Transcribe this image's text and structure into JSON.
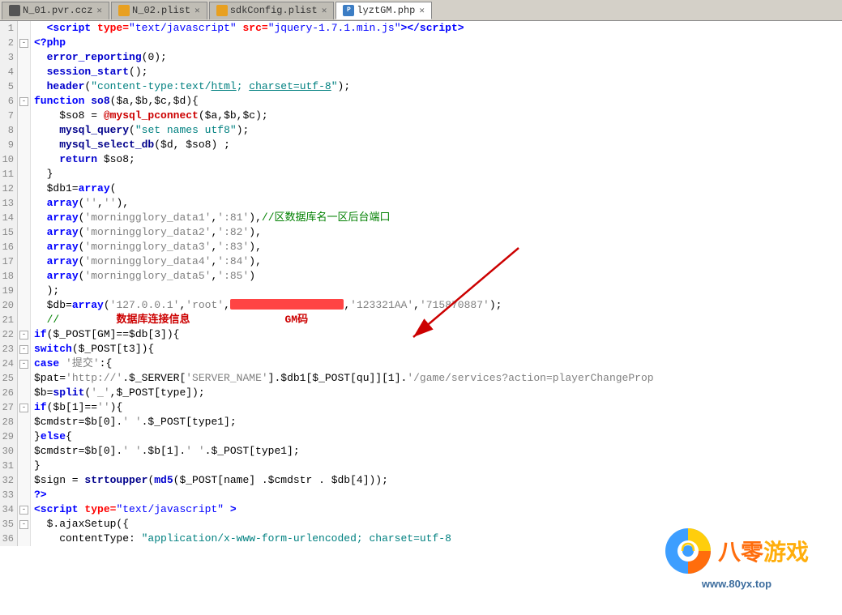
{
  "tabs": [
    {
      "id": "tab1",
      "label": "N_01.pvr.ccz",
      "type": "ccz",
      "active": false
    },
    {
      "id": "tab2",
      "label": "N_02.plist",
      "type": "plist",
      "active": false
    },
    {
      "id": "tab3",
      "label": "sdkConfig.plist",
      "type": "plist",
      "active": false
    },
    {
      "id": "tab4",
      "label": "lyztGM.php",
      "type": "php",
      "active": true
    }
  ],
  "lines": [
    {
      "num": "1",
      "fold": "",
      "code": "<script type=\"text/javascript\" src=\"jquery-1.7.1.min.js\"><\\/script>",
      "type": "html"
    },
    {
      "num": "2",
      "fold": "-",
      "code": "<?php",
      "type": "php-open"
    },
    {
      "num": "3",
      "fold": "",
      "code": "  error_reporting(0);",
      "type": "php"
    },
    {
      "num": "4",
      "fold": "",
      "code": "  session_start();",
      "type": "php"
    },
    {
      "num": "5",
      "fold": "",
      "code": "  header(\"content-type:text/html; charset=utf-8\");",
      "type": "php"
    },
    {
      "num": "6",
      "fold": "-",
      "code": "function so8($a,$b,$c,$d){",
      "type": "php-fn"
    },
    {
      "num": "7",
      "fold": "",
      "code": "    $so8 = @mysql_pconnect($a,$b,$c);",
      "type": "php"
    },
    {
      "num": "8",
      "fold": "",
      "code": "    mysql_query(\"set names utf8\");",
      "type": "php"
    },
    {
      "num": "9",
      "fold": "",
      "code": "    mysql_select_db($d, $so8) ;",
      "type": "php"
    },
    {
      "num": "10",
      "fold": "",
      "code": "    return $so8;",
      "type": "php"
    },
    {
      "num": "11",
      "fold": "",
      "code": "  }",
      "type": "php"
    },
    {
      "num": "12",
      "fold": "",
      "code": "  $db1=array(",
      "type": "php"
    },
    {
      "num": "13",
      "fold": "",
      "code": "  array('',''),",
      "type": "php"
    },
    {
      "num": "14",
      "fold": "",
      "code": "  array('morningglory_data1',':81'),//区数据库名一区后台端口",
      "type": "php-comment"
    },
    {
      "num": "15",
      "fold": "",
      "code": "  array('morningglory_data2',':82'),",
      "type": "php"
    },
    {
      "num": "16",
      "fold": "",
      "code": "  array('morningglory_data3',':83'),",
      "type": "php"
    },
    {
      "num": "17",
      "fold": "",
      "code": "  array('morningglory_data4',':84'),",
      "type": "php"
    },
    {
      "num": "18",
      "fold": "",
      "code": "  array('morningglory_data5',':85')",
      "type": "php"
    },
    {
      "num": "19",
      "fold": "",
      "code": "  );",
      "type": "php"
    },
    {
      "num": "20",
      "fold": "",
      "code": "  $db=array('127.0.0.1','root','REDACTED','123321AA','715870887');",
      "type": "php-redacted"
    },
    {
      "num": "21",
      "fold": "",
      "code": "  //          数据库连接信息                GM码",
      "type": "php-annotation"
    },
    {
      "num": "22",
      "fold": "-",
      "code": "if($_POST[GM]==$db[3]){",
      "type": "php-if"
    },
    {
      "num": "23",
      "fold": "-",
      "code": "switch($_POST[t3]){",
      "type": "php-switch"
    },
    {
      "num": "24",
      "fold": "-",
      "code": "case '提交':{",
      "type": "php-case"
    },
    {
      "num": "25",
      "fold": "",
      "code": "$pat='http://'.$_SERVER['SERVER_NAME'].$db1[$_POST[qu]][1].'/game/services?action=playerChangeProp",
      "type": "php"
    },
    {
      "num": "26",
      "fold": "",
      "code": "$b=split('_',$_POST[type]);",
      "type": "php"
    },
    {
      "num": "27",
      "fold": "-",
      "code": "if($b[1]==''){",
      "type": "php-if"
    },
    {
      "num": "28",
      "fold": "",
      "code": "$cmdstr=$b[0].' '.$_POST[type1];",
      "type": "php"
    },
    {
      "num": "29",
      "fold": "",
      "code": "}else{",
      "type": "php"
    },
    {
      "num": "30",
      "fold": "",
      "code": "$cmdstr=$b[0].' '.$b[1].' '.$_POST[type1];",
      "type": "php"
    },
    {
      "num": "31",
      "fold": "",
      "code": "}",
      "type": "php"
    },
    {
      "num": "32",
      "fold": "",
      "code": "$sign = strtoupper(md5($_POST[name] .$cmdstr . $db[4]));",
      "type": "php"
    },
    {
      "num": "33",
      "fold": "",
      "code": "?>",
      "type": "php-close"
    },
    {
      "num": "34",
      "fold": "-",
      "code": "<script type=\"text/javascript\" >",
      "type": "html"
    },
    {
      "num": "35",
      "fold": "-",
      "code": "  $.ajaxSetup({",
      "type": "js"
    },
    {
      "num": "36",
      "fold": "",
      "code": "    contentType: \"application/x-www-form-urlencoded; charset=utf-8",
      "type": "js"
    }
  ],
  "annotations": {
    "db_info_label": "数据库连接信息",
    "gm_label": "GM码",
    "arrow_label": ""
  },
  "watermark": {
    "text": "八零游戏",
    "url": "www.80yx.top"
  }
}
